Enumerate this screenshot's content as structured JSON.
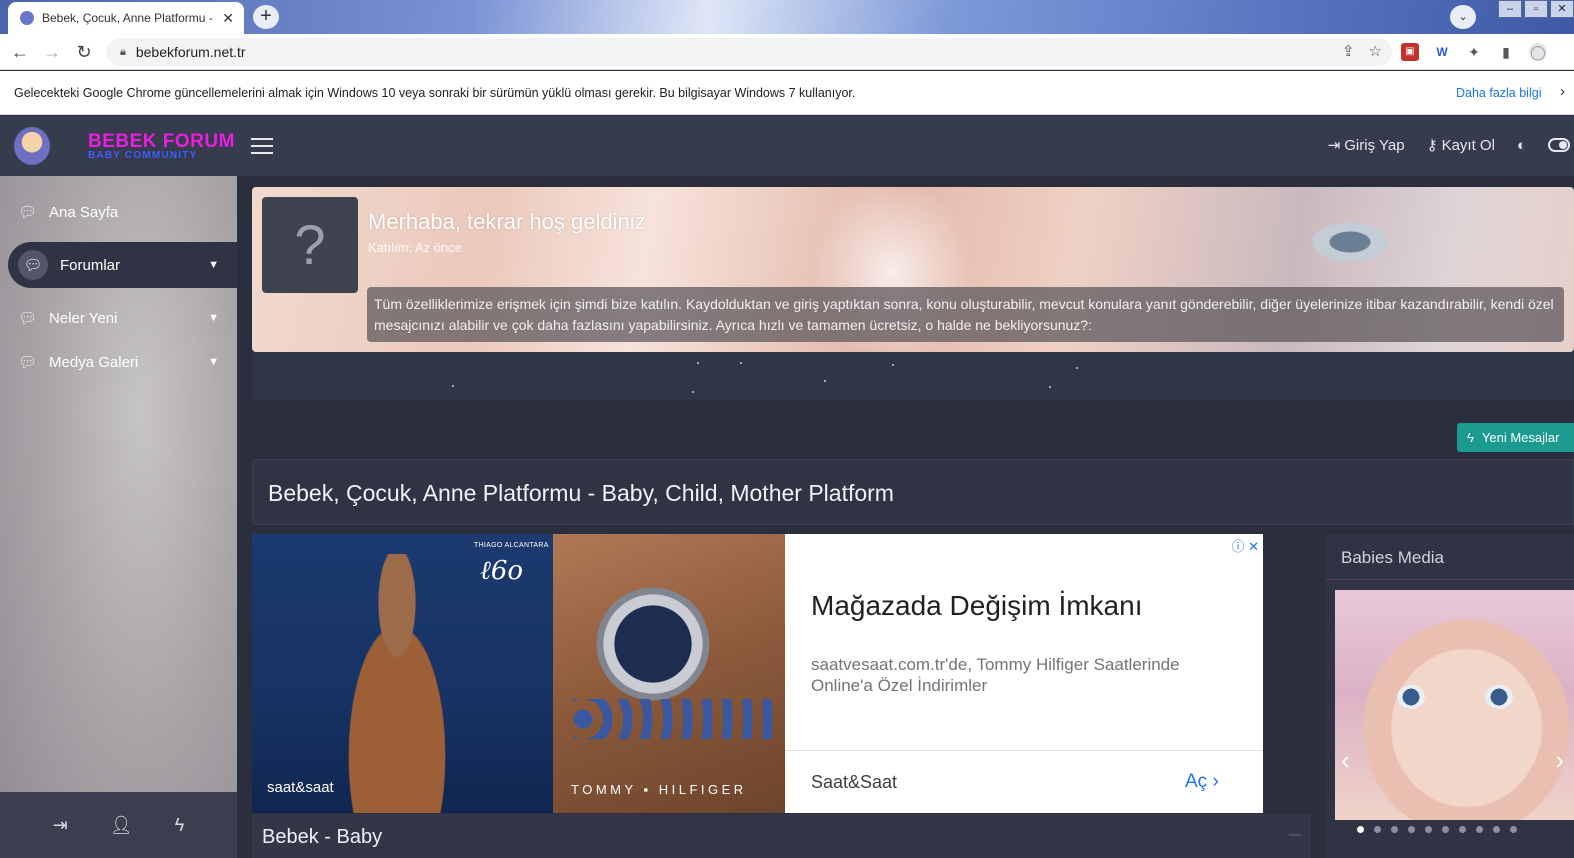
{
  "browser": {
    "tab_title": "Bebek, Çocuk, Anne Platformu - B",
    "tab_close": "✕",
    "new_tab": "+",
    "tab_search": "⌄",
    "url": "bebekforum.net.tr",
    "infobar_message": "Gelecekteki Google Chrome güncellemelerini almak için Windows 10 veya sonraki bir sürümün yüklü olması gerekir. Bu bilgisayar Windows 7 kullanıyor.",
    "infobar_link": "Daha fazla bilgi",
    "infobar_close": "›"
  },
  "site": {
    "brand_line1": "BEBEK FORUM",
    "brand_line2": "BABY COMMUNITY",
    "menu": [
      {
        "label": "Ana Sayfa",
        "icon": "chat-icon"
      },
      {
        "label": "Forumlar",
        "icon": "chat-icon",
        "active": true
      },
      {
        "label": "Neler Yeni",
        "icon": "chat-icon"
      },
      {
        "label": "Medya Galeri",
        "icon": "chat-icon"
      }
    ],
    "topbar": {
      "login": "Giriş Yap",
      "register": "Kayıt Ol"
    },
    "hero": {
      "avatar": "?",
      "welcome": "Merhaba, tekrar hoş geldiniz",
      "joined": "Katılım: Az önce",
      "description": "Tüm özelliklerimize erişmek için şimdi bize katılın. Kaydolduktan ve giriş yaptıktan sonra, konu oluşturabilir, mevcut konulara yanıt gönderebilir, diğer üyelerinize itibar kazandırabilir, kendi özel mesajcınızı alabilir ve çok daha fazlasını yapabilirsiniz. Ayrıca hızlı ve tamamen ücretsiz, o halde ne bekliyorsunuz?:"
    },
    "new_posts_button": "Yeni Mesajlar",
    "page_title": "Bebek, Çocuk, Anne Platformu - Baby, Child, Mother Platform",
    "ad": {
      "sig_name": "THIAGO ALCANTARA",
      "signature": "ℓ6o",
      "brand1": "saat&saat",
      "brand2": "TOMMY ▪ HILFIGER",
      "headline": "Mağazada Değişim İmkanı",
      "subtext": "saatvesaat.com.tr'de, Tommy Hilfiger Saatlerinde Online'a Özel İndirimler",
      "advertiser": "Saat&Saat",
      "cta": "Aç ›",
      "adchoices": "ⓘ ✕"
    },
    "section_title": "Bebek - Baby",
    "media": {
      "title": "Babies Media",
      "prev": "‹",
      "next": "›",
      "dots": 10,
      "active_dot": 0
    }
  },
  "colors": {
    "sidebar_dark": "#363b4d",
    "content_bg": "#2b2f3d",
    "accent_teal": "#1b9a8f",
    "brand_pink": "#e91ee0",
    "brand_blue": "#3b5cff",
    "link_blue": "#1a73e8"
  }
}
